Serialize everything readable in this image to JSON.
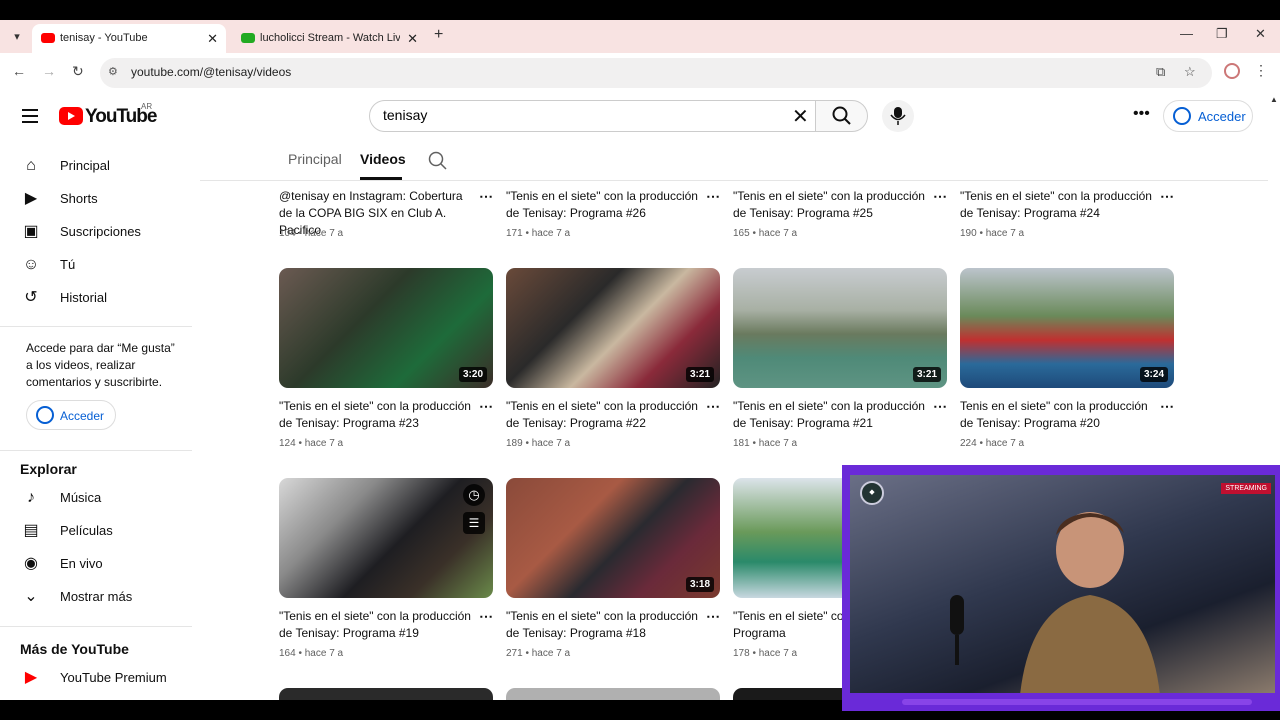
{
  "browser": {
    "tabs": [
      {
        "title": "tenisay - YouTube",
        "active": true,
        "favicon_color": "#ff0000"
      },
      {
        "title": "lucholicci Stream - Watch Live o",
        "active": false,
        "favicon_color": "#22aa22"
      }
    ],
    "url": "youtube.com/@tenisay/videos"
  },
  "header": {
    "logo_text": "YouTube",
    "country_code": "AR",
    "search_value": "tenisay",
    "signin_label": "Acceder"
  },
  "sidebar": {
    "main_items": [
      {
        "label": "Principal",
        "icon": "home-icon"
      },
      {
        "label": "Shorts",
        "icon": "shorts-icon"
      },
      {
        "label": "Suscripciones",
        "icon": "subscriptions-icon"
      },
      {
        "label": "Tú",
        "icon": "you-icon"
      },
      {
        "label": "Historial",
        "icon": "history-icon"
      }
    ],
    "signin_prompt": "Accede para dar “Me gusta” a los videos, realizar comentarios y suscribirte.",
    "signin_label": "Acceder",
    "explore_header": "Explorar",
    "explore_items": [
      {
        "label": "Música",
        "icon": "music-icon"
      },
      {
        "label": "Películas",
        "icon": "movies-icon"
      },
      {
        "label": "En vivo",
        "icon": "live-icon"
      },
      {
        "label": "Mostrar más",
        "icon": "chevron-down-icon"
      }
    ],
    "more_header": "Más de YouTube",
    "more_items": [
      {
        "label": "YouTube Premium",
        "icon": "youtube-premium-icon"
      }
    ]
  },
  "channel_tabs": [
    "Principal",
    "Videos"
  ],
  "videos": [
    {
      "title": "@tenisay en Instagram: Cobertura de la COPA BIG SIX en Club A. Pacifico",
      "views": "104",
      "age": "hace 7 a",
      "duration": ""
    },
    {
      "title": "\"Tenis en el siete\" con la producción de Tenisay: Programa #26",
      "views": "171",
      "age": "hace 7 a",
      "duration": ""
    },
    {
      "title": "\"Tenis en el siete\" con la producción de Tenisay: Programa #25",
      "views": "165",
      "age": "hace 7 a",
      "duration": ""
    },
    {
      "title": "\"Tenis en el siete\" con la producción de Tenisay: Programa #24",
      "views": "190",
      "age": "hace 7 a",
      "duration": ""
    },
    {
      "title": "\"Tenis en el siete\" con la producción de Tenisay: Programa #23",
      "views": "124",
      "age": "hace 7 a",
      "duration": "3:20"
    },
    {
      "title": "\"Tenis en el siete\" con la producción de Tenisay: Programa #22",
      "views": "189",
      "age": "hace 7 a",
      "duration": "3:21"
    },
    {
      "title": "\"Tenis en el siete\" con la producción de Tenisay: Programa #21",
      "views": "181",
      "age": "hace 7 a",
      "duration": "3:21"
    },
    {
      "title": "Tenis en el siete\" con la producción de Tenisay: Programa #20",
      "views": "224",
      "age": "hace 7 a",
      "duration": "3:24"
    },
    {
      "title": "\"Tenis en el siete\" con la producción de Tenisay: Programa #19",
      "views": "164",
      "age": "hace 7 a",
      "duration": ""
    },
    {
      "title": "\"Tenis en el siete\" con la producción de Tenisay: Programa #18",
      "views": "271",
      "age": "hace 7 a",
      "duration": "3:18"
    },
    {
      "title": "\"Tenis en el siete\" co de Tenisay: Programa",
      "views": "178",
      "age": "hace 7 a",
      "duration": ""
    }
  ],
  "overlay": {
    "badge": "STREAMING"
  },
  "colors": {
    "brand_red": "#ff0000",
    "link_blue": "#065fd4",
    "overlay_purple": "#6a2ad8"
  }
}
